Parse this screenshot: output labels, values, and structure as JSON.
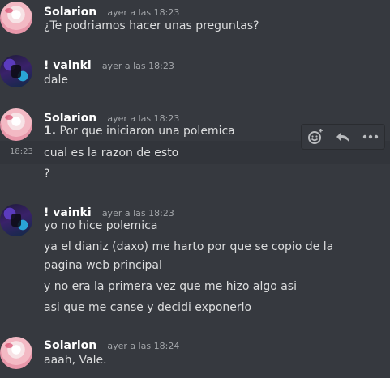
{
  "messages": [
    {
      "username": "Solarion",
      "timestamp": "ayer a las 18:23",
      "lines": [
        "¿Te podriamos hacer unas preguntas?"
      ]
    },
    {
      "username": "! vainki",
      "timestamp": "ayer a las 18:23",
      "lines": [
        "dale"
      ]
    },
    {
      "username": "Solarion",
      "timestamp": "ayer a las 18:23",
      "list_number": "1.",
      "lines": [
        "Por que iniciaron una polemica",
        "cual es la razon de esto",
        "?"
      ],
      "hover_time": "18:23"
    },
    {
      "username": "! vainki",
      "timestamp": "ayer a las 18:23",
      "lines": [
        "yo no hice polemica",
        "ya el dianiz (daxo) me harto por que se copio de la",
        "pagina web principal",
        "y no era la primera vez que me hizo algo asi",
        "asi que me canse y decidi exponerlo"
      ]
    },
    {
      "username": "Solarion",
      "timestamp": "ayer a las 18:24",
      "lines": [
        "aaah, Vale."
      ]
    }
  ],
  "toolbar": {
    "icons": [
      "add-reaction-icon",
      "reply-icon",
      "more-icon"
    ]
  },
  "colors": {
    "background": "#36393f",
    "hover_row": "#32353b",
    "username": "#ffffff",
    "text": "#dcddde",
    "muted": "#a3a6aa"
  }
}
